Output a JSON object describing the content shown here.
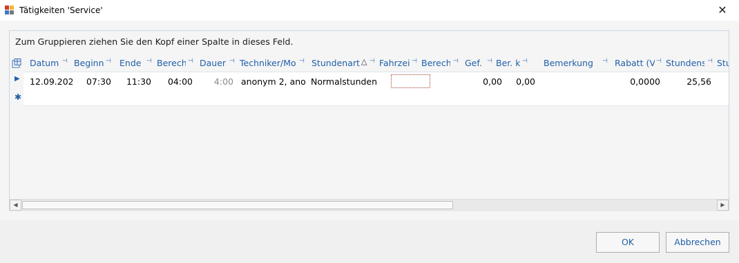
{
  "window": {
    "title": "Tätigkeiten 'Service'",
    "close_glyph": "✕",
    "icon": "app-form-icon"
  },
  "grid": {
    "group_panel_text": "Zum Gruppieren ziehen Sie den Kopf einer Spalte in dieses Feld.",
    "columns": [
      {
        "label": "Datum"
      },
      {
        "label": "Beginn"
      },
      {
        "label": "Ende"
      },
      {
        "label": "Berech"
      },
      {
        "label": "Dauer"
      },
      {
        "label": "Techniker/Mo"
      },
      {
        "label": "Stundenart"
      },
      {
        "label": "Fahrzei"
      },
      {
        "label": "Berech"
      },
      {
        "label": "Gef."
      },
      {
        "label": "Ber. k"
      },
      {
        "label": "Bemerkung"
      },
      {
        "label": "Rabatt (V"
      },
      {
        "label": "Stundens"
      },
      {
        "label": "Stu"
      }
    ],
    "pin_glyph": "⊣",
    "sort_glyph": "△",
    "rows": [
      {
        "datum": "12.09.202",
        "beginn": "07:30",
        "ende": "11:30",
        "berech": "04:00",
        "dauer": "4:00",
        "techniker": "anonym 2, ano",
        "stundenart": "Normalstunden",
        "fahrzeit": "",
        "berech2": "",
        "gef": "0,00",
        "ber_k": "0,00",
        "bemerkung": "",
        "rabatt": "0,0000",
        "stundensatz": "25,56",
        "stu": ""
      }
    ],
    "current_row_glyph": "▶",
    "new_row_glyph": "✱"
  },
  "buttons": {
    "ok": "OK",
    "cancel": "Abbrechen"
  }
}
